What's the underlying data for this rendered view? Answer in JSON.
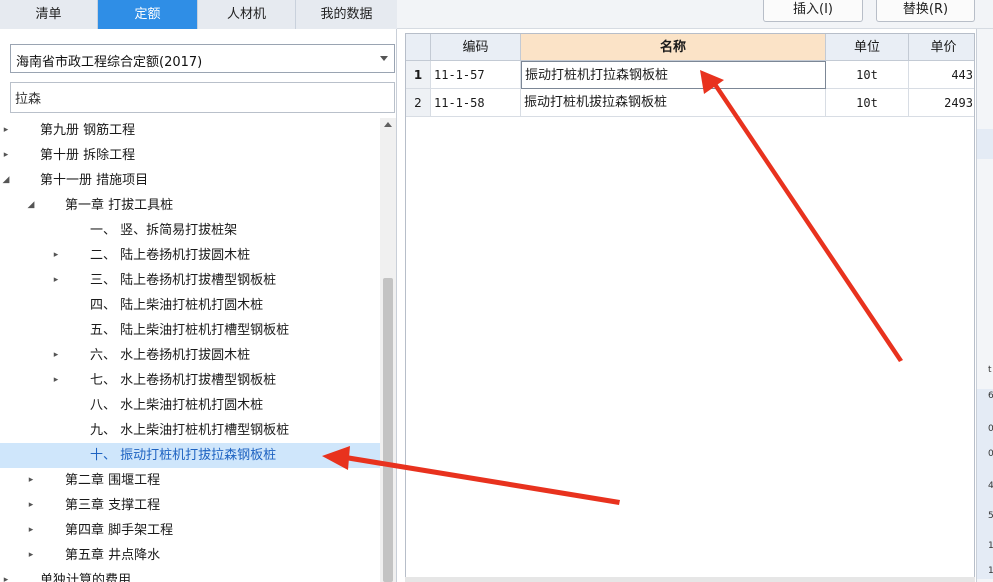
{
  "tabs": [
    {
      "label": "清单"
    },
    {
      "label": "定额"
    },
    {
      "label": "人材机"
    },
    {
      "label": "我的数据"
    }
  ],
  "toolbar": {
    "insert_label": "插入(I)",
    "replace_label": "替换(R)"
  },
  "quota_library": {
    "selected": "海南省市政工程综合定额(2017)"
  },
  "search": {
    "value": "拉森"
  },
  "tree": [
    {
      "label": "第九册 钢筋工程",
      "caret": "▸",
      "level": 0
    },
    {
      "label": "第十册 拆除工程",
      "caret": "▸",
      "level": 0
    },
    {
      "label": "第十一册 措施项目",
      "caret": "◢",
      "level": 0
    },
    {
      "label": "第一章 打拔工具桩",
      "caret": "◢",
      "level": 1
    },
    {
      "label": "一、 竖、拆简易打拔桩架",
      "caret": "",
      "level": 2
    },
    {
      "label": "二、 陆上卷扬机打拔圆木桩",
      "caret": "▸",
      "level": 2
    },
    {
      "label": "三、 陆上卷扬机打拔槽型钢板桩",
      "caret": "▸",
      "level": 2
    },
    {
      "label": "四、 陆上柴油打桩机打圆木桩",
      "caret": "",
      "level": 2
    },
    {
      "label": "五、 陆上柴油打桩机打槽型钢板桩",
      "caret": "",
      "level": 2
    },
    {
      "label": "六、 水上卷扬机打拔圆木桩",
      "caret": "▸",
      "level": 2
    },
    {
      "label": "七、 水上卷扬机打拔槽型钢板桩",
      "caret": "▸",
      "level": 2
    },
    {
      "label": "八、 水上柴油打桩机打圆木桩",
      "caret": "",
      "level": 2
    },
    {
      "label": "九、 水上柴油打桩机打槽型钢板桩",
      "caret": "",
      "level": 2
    },
    {
      "label": "十、 振动打桩机打拔拉森钢板桩",
      "caret": "",
      "level": 2,
      "selected": true
    },
    {
      "label": "第二章 围堰工程",
      "caret": "▸",
      "level": 1
    },
    {
      "label": "第三章 支撑工程",
      "caret": "▸",
      "level": 1
    },
    {
      "label": "第四章 脚手架工程",
      "caret": "▸",
      "level": 1
    },
    {
      "label": "第五章 井点降水",
      "caret": "▸",
      "level": 1
    },
    {
      "label": "单独计算的费用",
      "caret": "▸",
      "level": 0
    }
  ],
  "grid": {
    "columns": [
      "编码",
      "名称",
      "单位",
      "单价"
    ],
    "rows": [
      {
        "num": "1",
        "code": "11-1-57",
        "name": "振动打桩机打拉森钢板桩",
        "unit": "10t",
        "price": "443"
      },
      {
        "num": "2",
        "code": "11-1-58",
        "name": "振动打桩机拔拉森钢板桩",
        "unit": "10t",
        "price": "2493"
      }
    ]
  },
  "strip_marks": [
    "t",
    "6",
    "0",
    "0",
    "4",
    "5",
    "1",
    "1"
  ],
  "colors": {
    "active_tab": "#2f8ee6",
    "selection": "#cfe6fb",
    "name_header": "#fbe3c7",
    "arrow": "#e8321e"
  }
}
